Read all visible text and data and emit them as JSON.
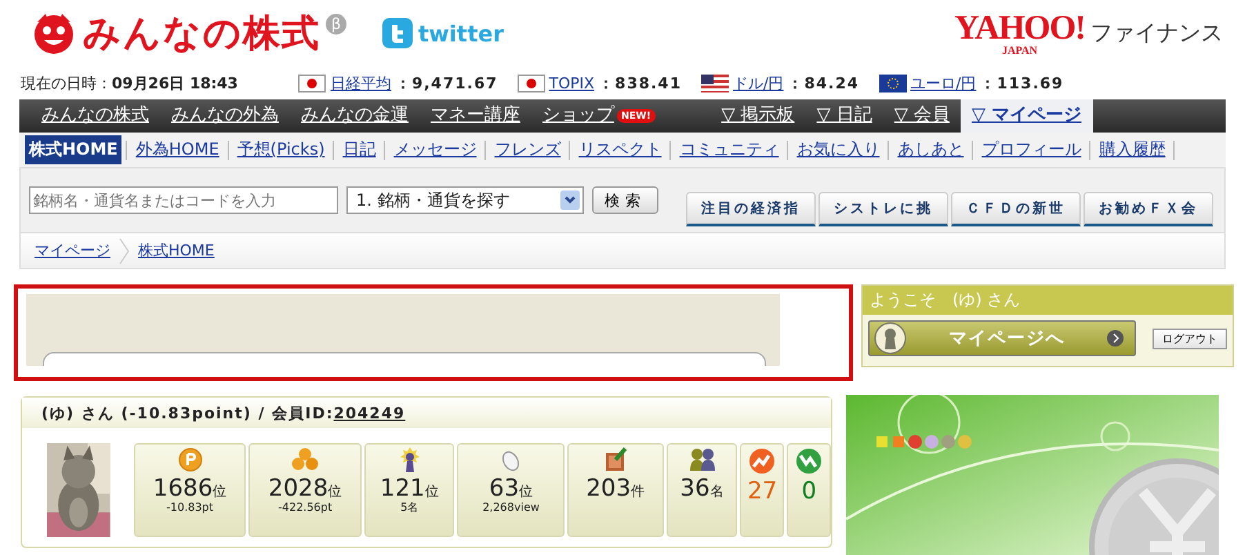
{
  "header": {
    "logo": "みんなの株式",
    "badge": "β",
    "twitter": "twitter",
    "yahoo": {
      "name": "YAHOO!",
      "sub": "JAPAN",
      "service": "ファイナンス"
    }
  },
  "ticker": {
    "label": "現在の日時：",
    "value": "09月26日 18:43",
    "quotes": [
      {
        "kind": "jp",
        "name": "日経平均",
        "value": "：9,471.67"
      },
      {
        "kind": "jp",
        "name": "TOPIX",
        "value": "：838.41"
      },
      {
        "kind": "us",
        "name": "ドル/円",
        "value": "：84.24"
      },
      {
        "kind": "eu",
        "name": "ユーロ/円",
        "value": "：113.69"
      }
    ]
  },
  "main_nav": [
    {
      "label": "みんなの株式",
      "selected": false
    },
    {
      "label": "みんなの外為",
      "selected": false
    },
    {
      "label": "みんなの金運",
      "selected": false
    },
    {
      "label": "マネー講座",
      "selected": false
    },
    {
      "label": "ショップ",
      "selected": false,
      "badge": "NEW!"
    },
    {
      "label": "▽ 掲示板",
      "selected": false
    },
    {
      "label": "▽ 日記",
      "selected": false
    },
    {
      "label": "▽ 会員",
      "selected": false
    },
    {
      "label": "▽ マイページ",
      "selected": true
    }
  ],
  "sub_nav": [
    {
      "label": "株式HOME",
      "selected": true
    },
    {
      "label": "外為HOME",
      "selected": false
    },
    {
      "label": "予想(Picks)",
      "selected": false
    },
    {
      "label": "日記",
      "selected": false
    },
    {
      "label": "メッセージ",
      "selected": false
    },
    {
      "label": "フレンズ",
      "selected": false
    },
    {
      "label": "リスペクト",
      "selected": false
    },
    {
      "label": "コミュニティ",
      "selected": false
    },
    {
      "label": "お気に入り",
      "selected": false
    },
    {
      "label": "あしあと",
      "selected": false
    },
    {
      "label": "プロフィール",
      "selected": false
    },
    {
      "label": "購入履歴",
      "selected": false
    }
  ],
  "search": {
    "placeholder": "銘柄名・通貨名またはコードを入力",
    "select": "1. 銘柄・通貨を探す",
    "button": "検索",
    "tabs": [
      "注目の経済指",
      "シストレに挑",
      "ＣＦＤの新世",
      "お勧めＦＸ会"
    ]
  },
  "breadcrumb": [
    "マイページ",
    "株式HOME"
  ],
  "welcome": {
    "title": "ようこそ　(ゆ) さん",
    "button": "マイページへ",
    "logout": "ログアウト"
  },
  "profile": {
    "name": "(ゆ) さん (-10.83point) / 会員ID:",
    "id": "204249",
    "stats": [
      {
        "kind": "coin",
        "value": "1686",
        "unit": "位",
        "sub": "-10.83pt"
      },
      {
        "kind": "coins",
        "value": "2028",
        "unit": "位",
        "sub": "-422.56pt"
      },
      {
        "kind": "trophy",
        "value": "121",
        "unit": "位",
        "sub": "5名"
      },
      {
        "kind": "mouse",
        "value": "63",
        "unit": "位",
        "sub": "2,268view"
      },
      {
        "kind": "book",
        "value": "203",
        "unit": "件"
      },
      {
        "kind": "people",
        "value": "36",
        "unit": "名"
      },
      {
        "kind": "up-badge",
        "value": "27",
        "color": "#e06010"
      },
      {
        "kind": "down-badge",
        "value": "0",
        "color": "#108020"
      }
    ]
  }
}
